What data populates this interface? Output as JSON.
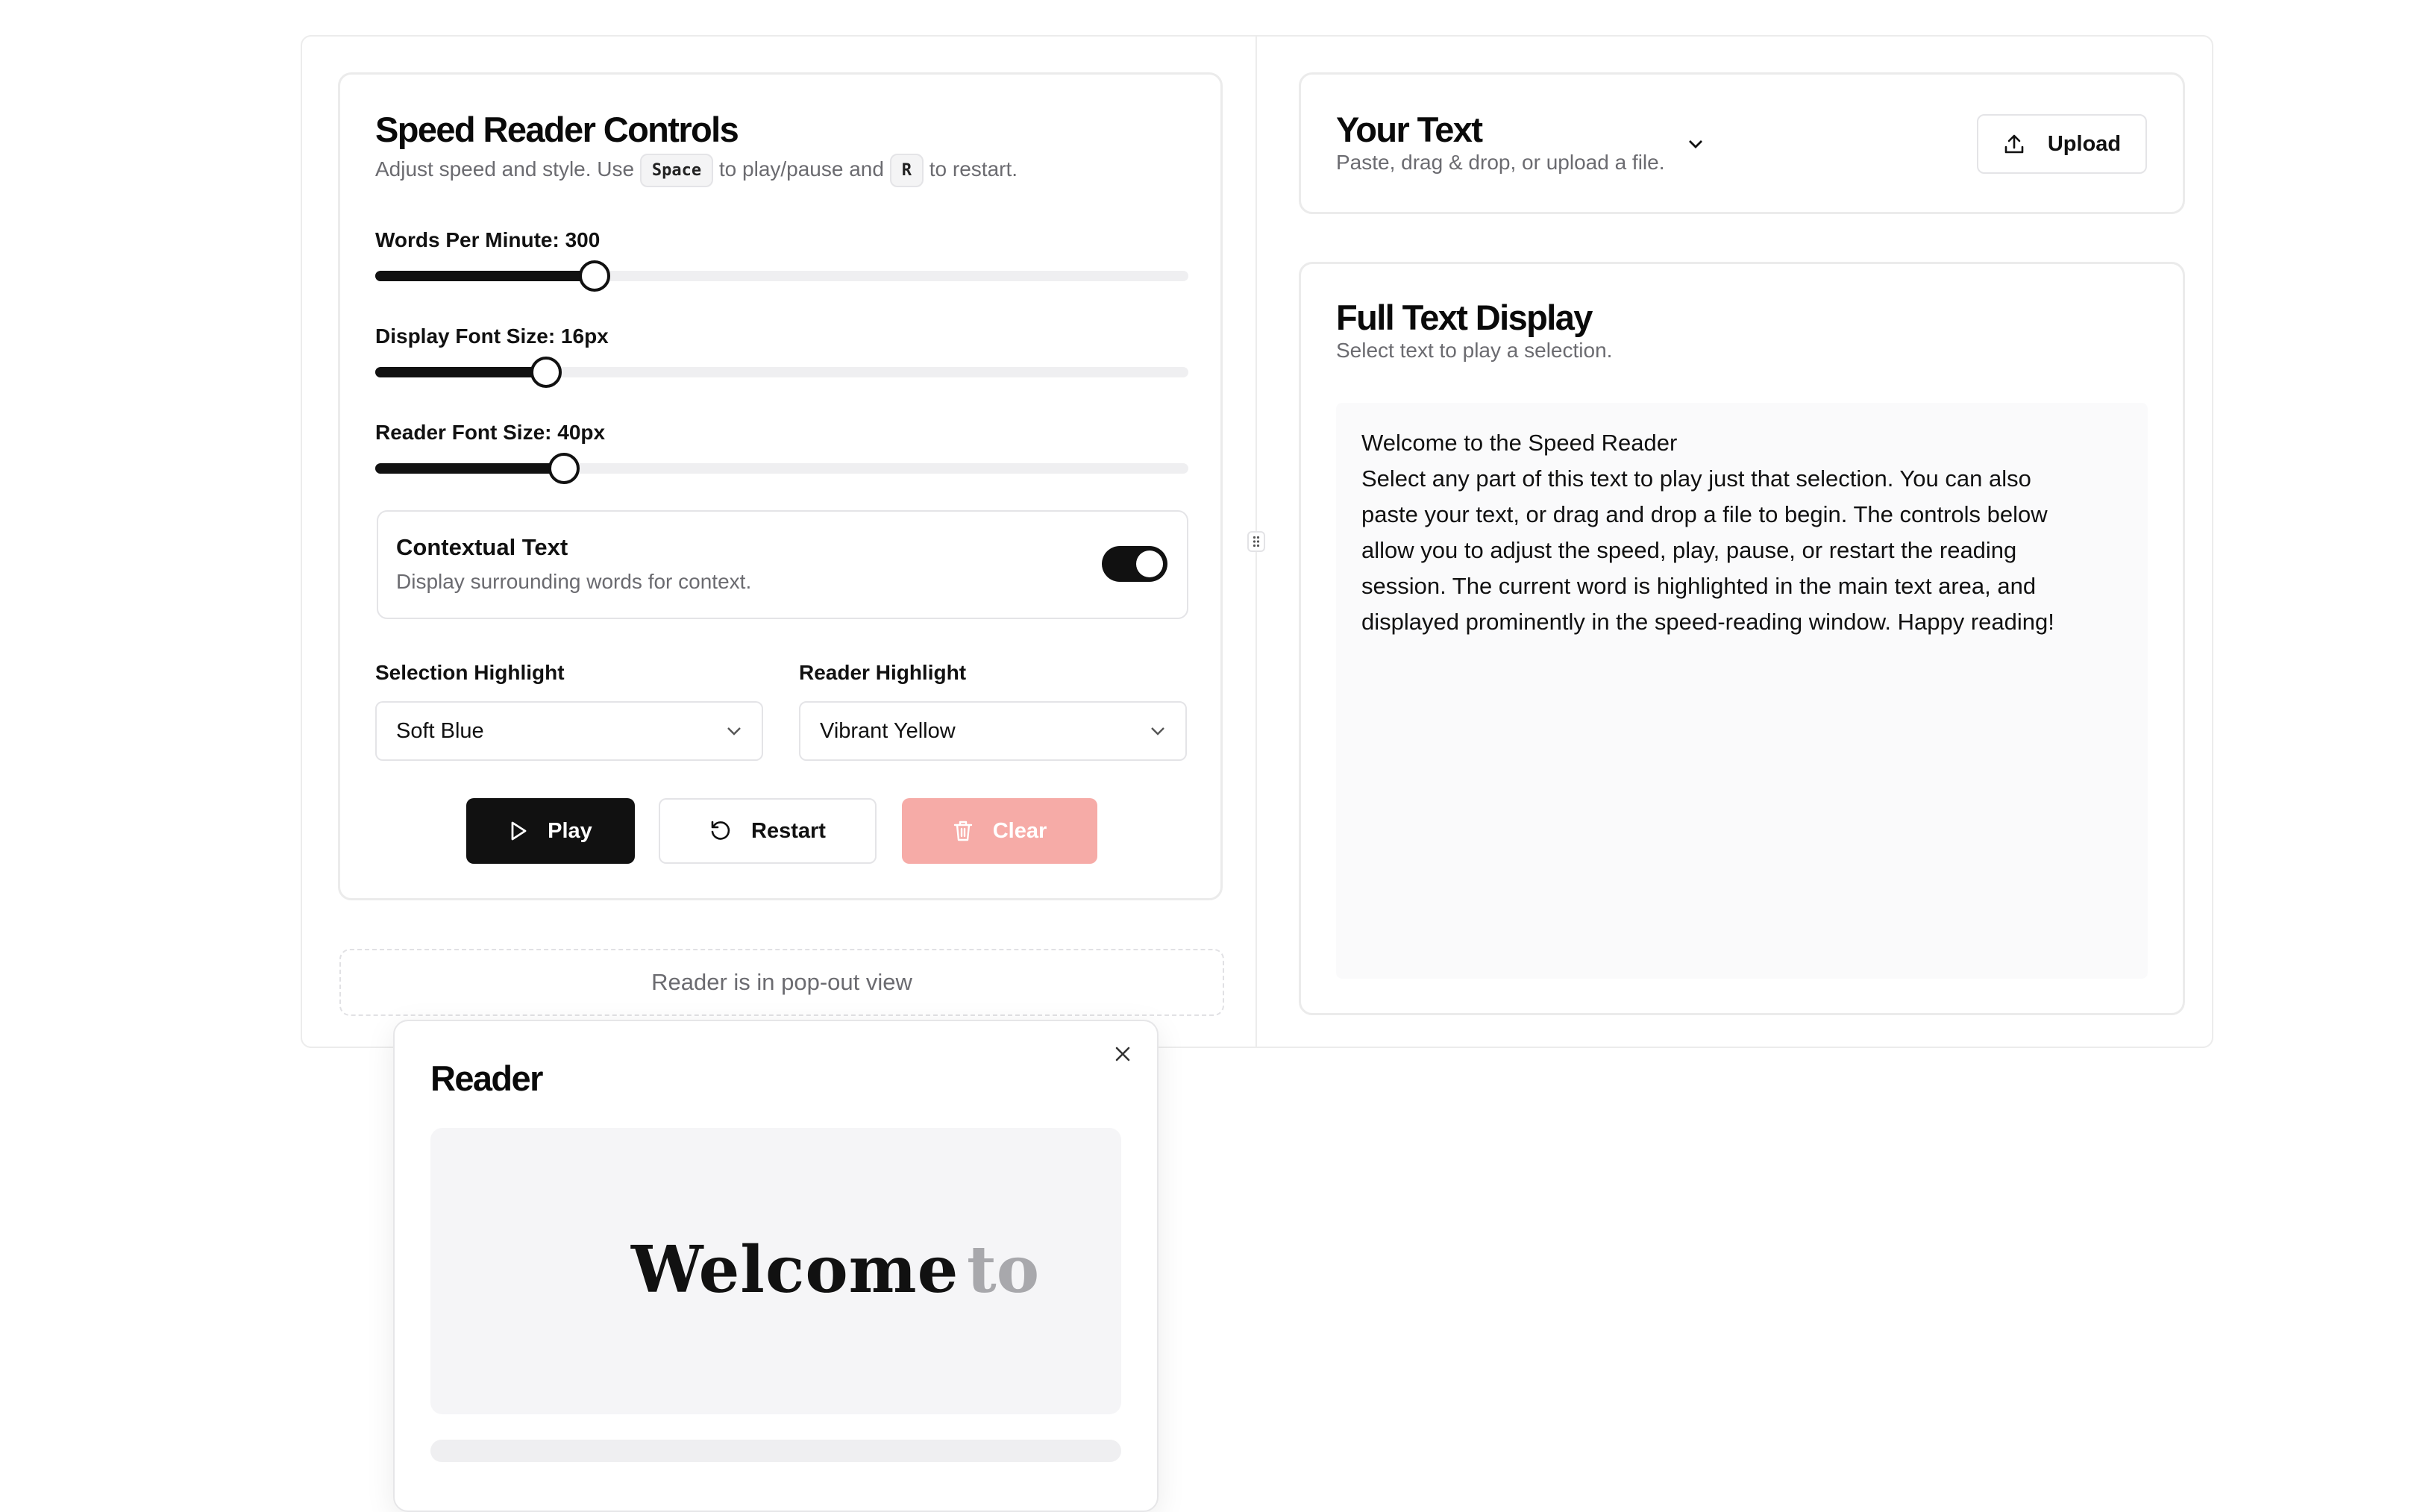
{
  "controls": {
    "title": "Speed Reader Controls",
    "subtitle_pre": "Adjust speed and style. Use",
    "kbd_space": "Space",
    "subtitle_mid": "to play/pause and",
    "kbd_r": "R",
    "subtitle_post": "to restart.",
    "sliders": [
      {
        "label": "Words Per Minute: 300",
        "fraction": 0.27
      },
      {
        "label": "Display Font Size: 16px",
        "fraction": 0.21
      },
      {
        "label": "Reader Font Size: 40px",
        "fraction": 0.232
      }
    ],
    "contextual": {
      "title": "Contextual Text",
      "desc": "Display surrounding words for context.",
      "enabled": true
    },
    "selection_highlight": {
      "label": "Selection Highlight",
      "value": "Soft Blue"
    },
    "reader_highlight": {
      "label": "Reader Highlight",
      "value": "Vibrant Yellow"
    },
    "buttons": {
      "play": "Play",
      "restart": "Restart",
      "clear": "Clear"
    }
  },
  "popout_placeholder": "Reader is in pop-out view",
  "your_text": {
    "title": "Your Text",
    "subtitle": "Paste, drag & drop, or upload a file.",
    "upload": "Upload"
  },
  "full_text": {
    "title": "Full Text Display",
    "subtitle": "Select text to play a selection.",
    "heading": "Welcome to the Speed Reader",
    "lines": [
      "Select any part of this text to play just that selection. You can also",
      "paste your text, or drag and drop a file to begin. The controls below",
      "allow you to adjust the speed, play, pause, or restart the reading",
      "session. The current word is highlighted in the main text area, and",
      "displayed prominently in the speed-reading window. Happy reading!"
    ]
  },
  "reader": {
    "title": "Reader",
    "current_word": "Welcome",
    "next_word": "to",
    "progress_fraction": 0.0
  },
  "colors": {
    "primary": "#111111",
    "clear_button": "#f6aba7",
    "panel_bg": "#f5f5f7"
  }
}
